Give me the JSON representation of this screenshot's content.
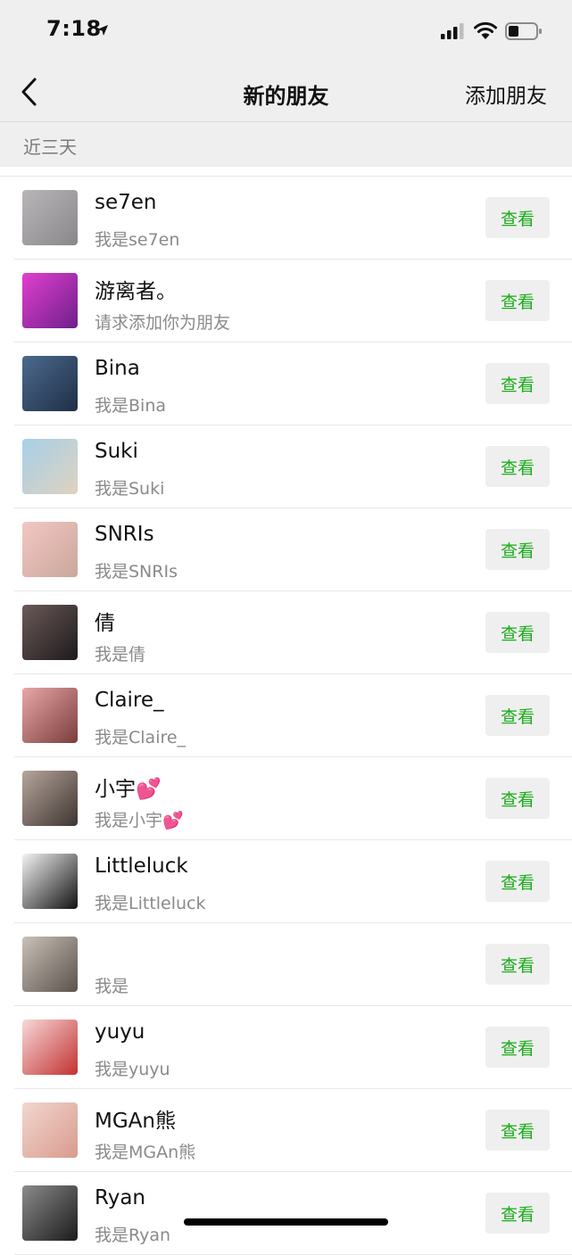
{
  "status_bar": {
    "time": "7:18"
  },
  "nav": {
    "title": "新的朋友",
    "action_label": "添加朋友"
  },
  "section": {
    "title": "近三天"
  },
  "view_label": "查看",
  "friends": [
    {
      "name": "se7en",
      "message": "我是se7en",
      "avatar_colors": [
        "#b9b6b8",
        "#8a878b"
      ]
    },
    {
      "name": "游离者。",
      "message": "请求添加你为朋友",
      "avatar_colors": [
        "#e23fd0",
        "#6e1f8a"
      ]
    },
    {
      "name": "Bina",
      "message": "我是Bina",
      "avatar_colors": [
        "#4b6a8c",
        "#1f2f47"
      ]
    },
    {
      "name": "Suki",
      "message": "我是Suki",
      "avatar_colors": [
        "#a7cfe8",
        "#ded3c0"
      ]
    },
    {
      "name": "SNRIs",
      "message": "我是SNRIs",
      "avatar_colors": [
        "#f3c7c4",
        "#c9a79a"
      ]
    },
    {
      "name": "倩",
      "message": "我是倩",
      "avatar_colors": [
        "#6a5a58",
        "#1e1a1c"
      ]
    },
    {
      "name": "Claire_",
      "message": "我是Claire_",
      "avatar_colors": [
        "#e9a7a7",
        "#7b3c3c"
      ]
    },
    {
      "name": "小宇💕",
      "message": "我是小宇💕",
      "avatar_colors": [
        "#b6a59b",
        "#3f3532"
      ]
    },
    {
      "name": "Littleluck",
      "message": "我是Littleluck",
      "avatar_colors": [
        "#f4f4f4",
        "#111111"
      ]
    },
    {
      "name": "",
      "message": "我是",
      "avatar_colors": [
        "#c9c0b7",
        "#5b524c"
      ]
    },
    {
      "name": "yuyu",
      "message": "我是yuyu",
      "avatar_colors": [
        "#f7d9d9",
        "#c2312f"
      ]
    },
    {
      "name": "MGAn熊",
      "message": "我是MGAn熊",
      "avatar_colors": [
        "#f2d6cf",
        "#d89b8d"
      ]
    },
    {
      "name": "Ryan",
      "message": "我是Ryan",
      "avatar_colors": [
        "#8b8b8b",
        "#1b1b1b"
      ]
    }
  ]
}
